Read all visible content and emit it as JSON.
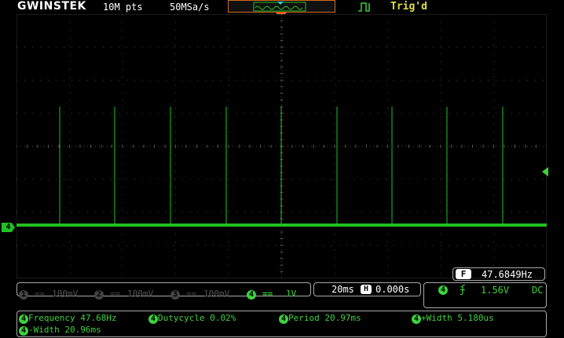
{
  "header": {
    "brand": "GWINSTEK",
    "record_length": "10M pts",
    "sample_rate": "50MSa/s",
    "trigger_status": "Trig'd"
  },
  "channels": [
    {
      "id": "1",
      "coupling": "==",
      "scale": "100mV",
      "active": false
    },
    {
      "id": "2",
      "coupling": "==",
      "scale": "100mV",
      "active": false
    },
    {
      "id": "3",
      "coupling": "==",
      "scale": "100mV",
      "active": false
    },
    {
      "id": "4",
      "coupling": "==",
      "scale": "1V",
      "active": true
    }
  ],
  "ch4_marker": "4",
  "timebase": {
    "scale": "20ms",
    "h_label": "H",
    "position": "0.000s"
  },
  "trigger": {
    "source": "4",
    "slope_symbol": "ʄ",
    "level": "1.56V",
    "coupling": "DC"
  },
  "counter": {
    "label": "F",
    "value": "47.6849Hz"
  },
  "measurements": [
    {
      "ch": "4",
      "text": "Frequency 47.68Hz"
    },
    {
      "ch": "4",
      "text": "Dutycycle 0.02%"
    },
    {
      "ch": "4",
      "text": "Period 20.97ms"
    },
    {
      "ch": "4",
      "text": "+Width 5.180us"
    },
    {
      "ch": "4",
      "text": "-Width 20.96ms"
    }
  ],
  "colors": {
    "ch4": "#22c022",
    "trigger_marker": "#ff5a1e",
    "trig_text": "#dede42"
  }
}
